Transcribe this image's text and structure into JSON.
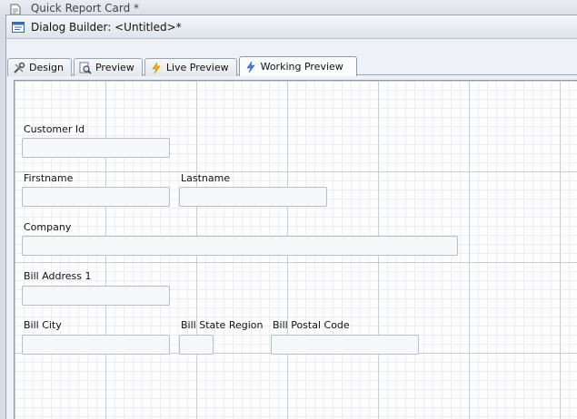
{
  "background_window": {
    "title": "Quick Report Card *"
  },
  "window": {
    "title": "Dialog Builder: <Untitled>*"
  },
  "tabs": [
    {
      "label": "Design",
      "icon": "tools-icon"
    },
    {
      "label": "Preview",
      "icon": "magnifier-icon"
    },
    {
      "label": "Live Preview",
      "icon": "lightning-icon"
    },
    {
      "label": "Working Preview",
      "icon": "lightning-icon",
      "active": true
    }
  ],
  "form": {
    "customer_id": {
      "label": "Customer Id",
      "value": ""
    },
    "firstname": {
      "label": "Firstname",
      "value": ""
    },
    "lastname": {
      "label": "Lastname",
      "value": ""
    },
    "company": {
      "label": "Company",
      "value": ""
    },
    "bill_address_1": {
      "label": "Bill Address 1",
      "value": ""
    },
    "bill_city": {
      "label": "Bill City",
      "value": ""
    },
    "bill_state_region": {
      "label": "Bill State Region",
      "value": ""
    },
    "bill_postal_code": {
      "label": "Bill Postal Code",
      "value": ""
    }
  },
  "colors": {
    "grid_major": "#c8cdd4",
    "grid_minor": "#eceef1",
    "lightning": "#e8a800",
    "lightning_active": "#3a6fd8"
  }
}
